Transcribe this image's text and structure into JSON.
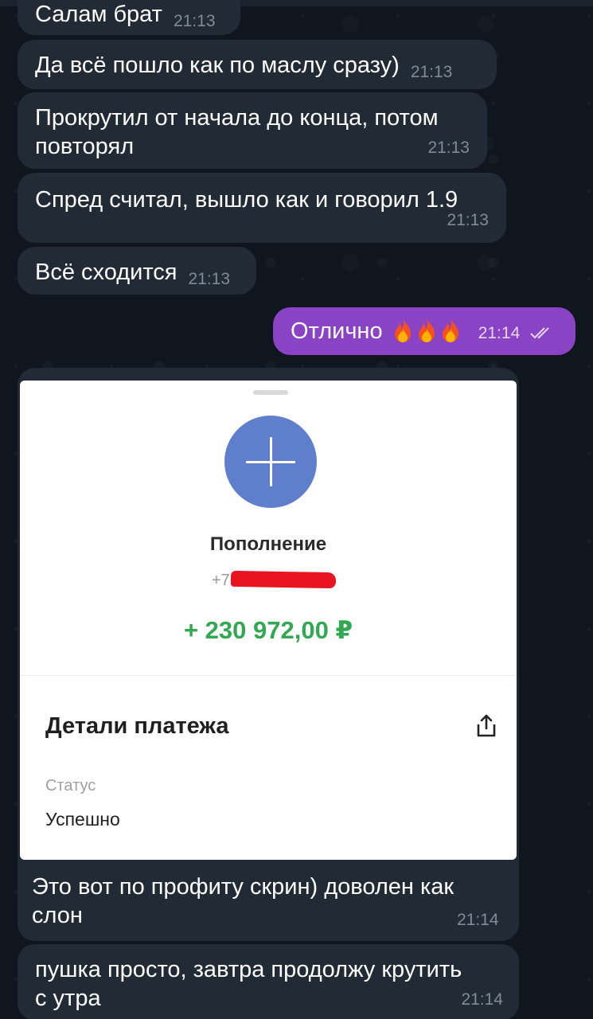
{
  "messages": [
    {
      "text": "Салам брат",
      "time": "21:13"
    },
    {
      "text": "Да всё пошло как по маслу сразу)",
      "time": "21:13"
    },
    {
      "text_line1": "Прокрутил от начала до конца, потом",
      "text_line2": "повторял",
      "time": "21:13"
    },
    {
      "text": "Спред  считал, вышло как и говорил 1.9",
      "time": "21:13"
    },
    {
      "text": "Всё сходится",
      "time": "21:13"
    }
  ],
  "outgoing": {
    "text": "Отлично",
    "emoji": [
      "fire-icon",
      "fire-icon",
      "fire-icon"
    ],
    "time": "21:14",
    "status": "read"
  },
  "payment_card": {
    "title": "Пополнение",
    "phone_prefix": "+7",
    "amount": "+ 230 972,00 ₽",
    "details_title": "Детали платежа",
    "status_label": "Статус",
    "status_value": "Успешно"
  },
  "photo_caption": {
    "line1": "Это вот по профиту скрин) доволен как",
    "line2": "слон",
    "time": "21:14"
  },
  "last_message": {
    "line1": "пушка просто, завтра продолжу крутить",
    "line2": "с утра",
    "time": "21:14"
  },
  "colors": {
    "incoming_bubble": "#222b35",
    "outgoing_bubble": "#8a43c4",
    "amount_green": "#33a852",
    "avatar_blue": "#5f7ecb"
  }
}
